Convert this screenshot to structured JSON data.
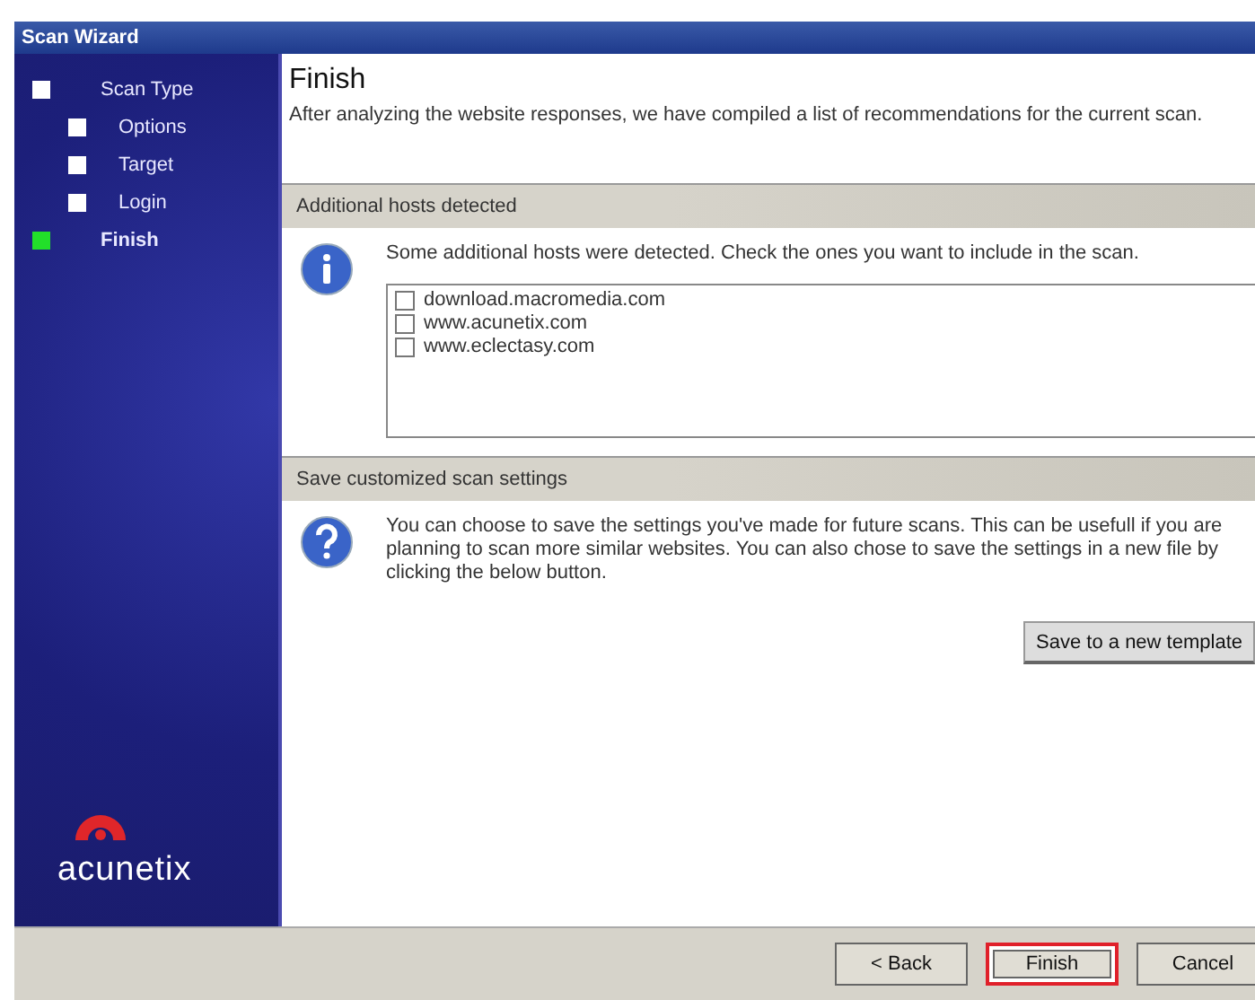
{
  "window": {
    "title": "Scan Wizard"
  },
  "steps": [
    {
      "label": "Scan Type",
      "selected": false
    },
    {
      "label": "Options",
      "selected": false
    },
    {
      "label": "Target",
      "selected": false
    },
    {
      "label": "Login",
      "selected": false
    },
    {
      "label": "Finish",
      "selected": true
    }
  ],
  "brand": {
    "name": "acunetix"
  },
  "page": {
    "title": "Finish",
    "subtitle": "After analyzing the website responses, we have compiled a list of recommendations for the current scan."
  },
  "hosts_section": {
    "header": "Additional hosts detected",
    "message": "Some additional hosts were detected. Check the ones you want to include in the scan.",
    "hosts": [
      {
        "label": "download.macromedia.com",
        "checked": false
      },
      {
        "label": "www.acunetix.com",
        "checked": false
      },
      {
        "label": "www.eclectasy.com",
        "checked": false
      }
    ]
  },
  "save_section": {
    "header": "Save customized scan settings",
    "message": "You can choose to save the settings you've made for future scans. This can be usefull if you are planning to scan more similar websites. You can also chose to save the settings in a new file by clicking the below button.",
    "button": "Save to a new template"
  },
  "buttons": [
    {
      "label": "< Back",
      "highlighted": false
    },
    {
      "label": "Finish",
      "highlighted": true
    },
    {
      "label": "Cancel",
      "highlighted": false
    }
  ]
}
